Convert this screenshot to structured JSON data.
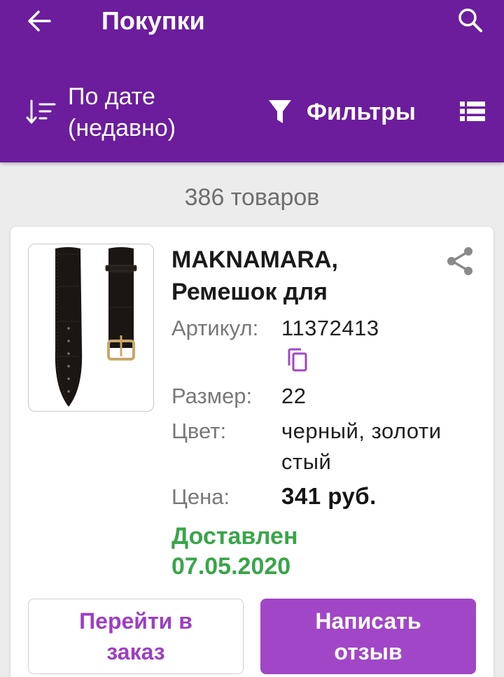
{
  "appbar": {
    "title": "Покупки",
    "back_icon": "arrow-left-icon",
    "search_icon": "search-icon",
    "sort_icon": "sort-icon",
    "sort_label": "По дате (недавно)",
    "filter_icon": "filter-funnel-icon",
    "filter_label": "Фильтры",
    "view_icon": "list-view-icon",
    "color": "#6b1d9c"
  },
  "count_text": "386 товаров",
  "product": {
    "image": "black-leather-watch-strap",
    "name": "MAKNAMARA, Ремешок для",
    "share_icon": "share-icon",
    "copy_icon": "copy-icon",
    "fields": {
      "article_label": "Артикул:",
      "article_value": "11372413",
      "size_label": "Размер:",
      "size_value": "22",
      "color_label": "Цвет:",
      "color_value": "черный, золотистый",
      "price_label": "Цена:",
      "price_value": "341 руб."
    },
    "status": "Доставлен 07.05.2020",
    "status_color": "#3aa54a"
  },
  "actions": {
    "go_to_order": "Перейти в заказ",
    "write_review": "Написать отзыв",
    "accent_color": "#a146c6"
  }
}
